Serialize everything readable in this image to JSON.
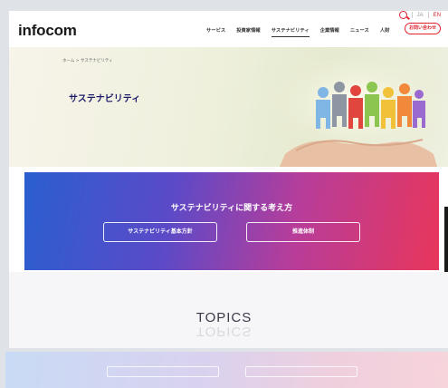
{
  "header": {
    "logo": "infocom",
    "nav": [
      "サービス",
      "投資家情報",
      "サステナビリティ",
      "企業情報",
      "ニュース",
      "人財"
    ],
    "nav_active": "サステナビリティ",
    "lang_ja": "JA",
    "lang_en": "EN",
    "contact_label": "お問い合わせ"
  },
  "hero": {
    "breadcrumb": "ホーム > サステナビリティ",
    "title": "サステナビリティ"
  },
  "banner": {
    "title": "サステナビリティに関する考え方",
    "button_policy": "サステナビリティ基本方針",
    "button_structure": "推進体制"
  },
  "topics": {
    "heading": "TOPICS"
  },
  "colors": {
    "brand_red": "#e0222c",
    "navy": "#1d1d6b",
    "banner_left": "#2a5fd0",
    "banner_right": "#e8365b"
  },
  "icons": [
    "search-icon"
  ]
}
